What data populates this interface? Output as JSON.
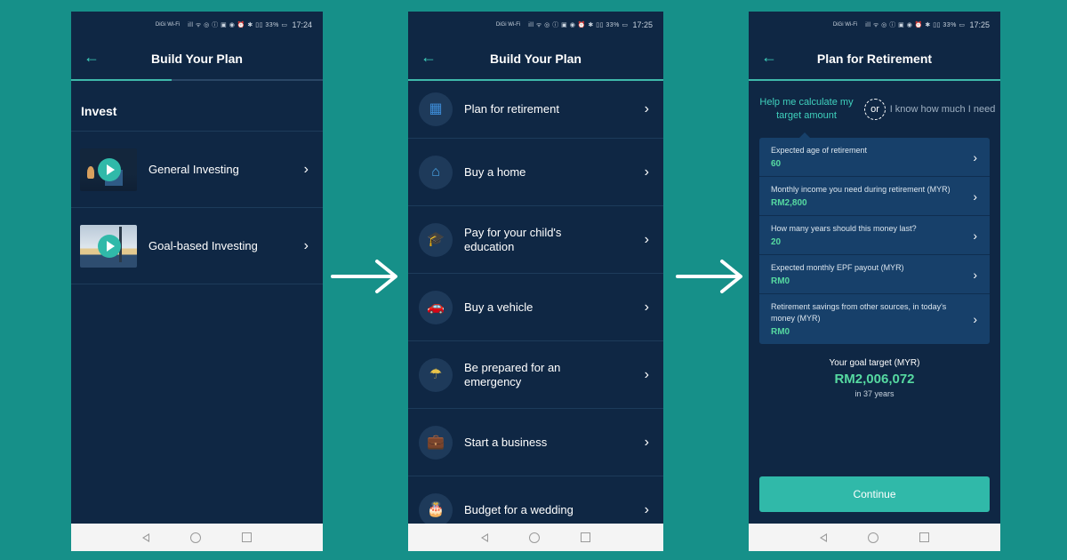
{
  "status_bar": {
    "carrier": "DiGi Wi-Fi",
    "icons": "ill ᯤ ◎ ⓘ ▣   ◉ ⏰ ✱ ▯▯ 33% ▭",
    "times": [
      "17:24",
      "17:25",
      "17:25"
    ]
  },
  "phone1": {
    "title": "Build Your Plan",
    "progress": 0.4,
    "section": "Invest",
    "items": [
      {
        "label": "General Investing"
      },
      {
        "label": "Goal-based Investing"
      }
    ]
  },
  "phone2": {
    "title": "Build Your Plan",
    "progress": 1.0,
    "items": [
      {
        "label": "Plan for retirement",
        "icon": "retirement-icon",
        "glyph": "▦",
        "color": "#3d8bd6"
      },
      {
        "label": "Buy a home",
        "icon": "home-icon",
        "glyph": "⌂",
        "color": "#4aa6e8"
      },
      {
        "label": "Pay for your child's education",
        "icon": "graduation-cap-icon",
        "glyph": "🎓",
        "color": "#7fb0d8"
      },
      {
        "label": "Buy a vehicle",
        "icon": "car-icon",
        "glyph": "🚗",
        "color": "#4fc98a"
      },
      {
        "label": "Be prepared for an emergency",
        "icon": "umbrella-icon",
        "glyph": "☂",
        "color": "#e8c34a"
      },
      {
        "label": "Start a business",
        "icon": "briefcase-icon",
        "glyph": "💼",
        "color": "#e08a7a"
      },
      {
        "label": "Budget for a wedding",
        "icon": "wedding-cake-icon",
        "glyph": "🎂",
        "color": "#b06ad8"
      }
    ]
  },
  "phone3": {
    "title": "Plan for Retirement",
    "progress": 1.0,
    "option_calculate": "Help me calculate my target amount",
    "or_label": "or",
    "option_know": "I know how much I need",
    "fields": [
      {
        "label": "Expected age of retirement",
        "value": "60"
      },
      {
        "label": "Monthly income you need during retirement (MYR)",
        "value": "RM2,800"
      },
      {
        "label": "How many years should this money last?",
        "value": "20"
      },
      {
        "label": "Expected monthly EPF payout (MYR)",
        "value": "RM0"
      },
      {
        "label": "Retirement savings from other sources, in today's money (MYR)",
        "value": "RM0"
      }
    ],
    "goal_label": "Your goal target (MYR)",
    "goal_value": "RM2,006,072",
    "goal_sub": "in 37 years",
    "continue_label": "Continue"
  },
  "colors": {
    "background": "#169089",
    "screen": "#0f2744",
    "accent": "#30b9a9",
    "value_green": "#56d9a1"
  }
}
